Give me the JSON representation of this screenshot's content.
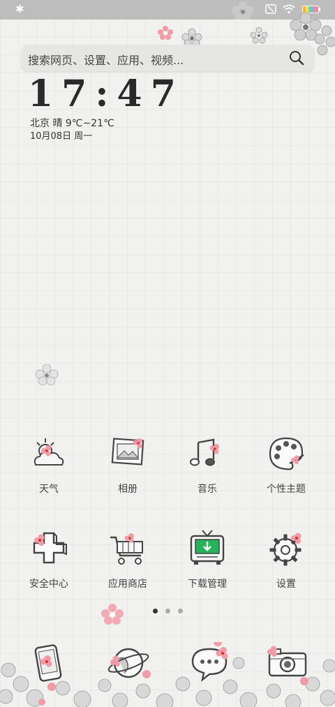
{
  "status_bar": {
    "bluetooth_icon": "bluetooth-icon",
    "wifi_icon": "wifi-icon",
    "battery_icon": "battery-icon",
    "sim_icon": "no-sim-icon"
  },
  "search": {
    "placeholder": "搜索网页、设置、应用、视频..."
  },
  "clock": {
    "time": "17:47",
    "weather": "北京  晴  9℃~21℃",
    "date": "10月08日 周一"
  },
  "apps_row1": [
    {
      "label": "天气",
      "icon": "weather-cloud-icon"
    },
    {
      "label": "相册",
      "icon": "photo-album-icon"
    },
    {
      "label": "音乐",
      "icon": "music-note-icon"
    },
    {
      "label": "个性主题",
      "icon": "theme-palette-icon"
    }
  ],
  "apps_row2": [
    {
      "label": "安全中心",
      "icon": "security-plus-icon"
    },
    {
      "label": "应用商店",
      "icon": "shopping-cart-icon"
    },
    {
      "label": "下载管理",
      "icon": "download-tv-icon"
    },
    {
      "label": "设置",
      "icon": "settings-gear-icon"
    }
  ],
  "page_indicator": {
    "count": 3,
    "active": 1
  },
  "dock": [
    {
      "icon": "phone-icon"
    },
    {
      "icon": "browser-globe-icon"
    },
    {
      "icon": "messages-bubble-icon"
    },
    {
      "icon": "camera-icon"
    }
  ],
  "colors": {
    "background": "#f1f1f0",
    "flower_pink": "#f29aa6",
    "accent_green": "#27b35a"
  }
}
